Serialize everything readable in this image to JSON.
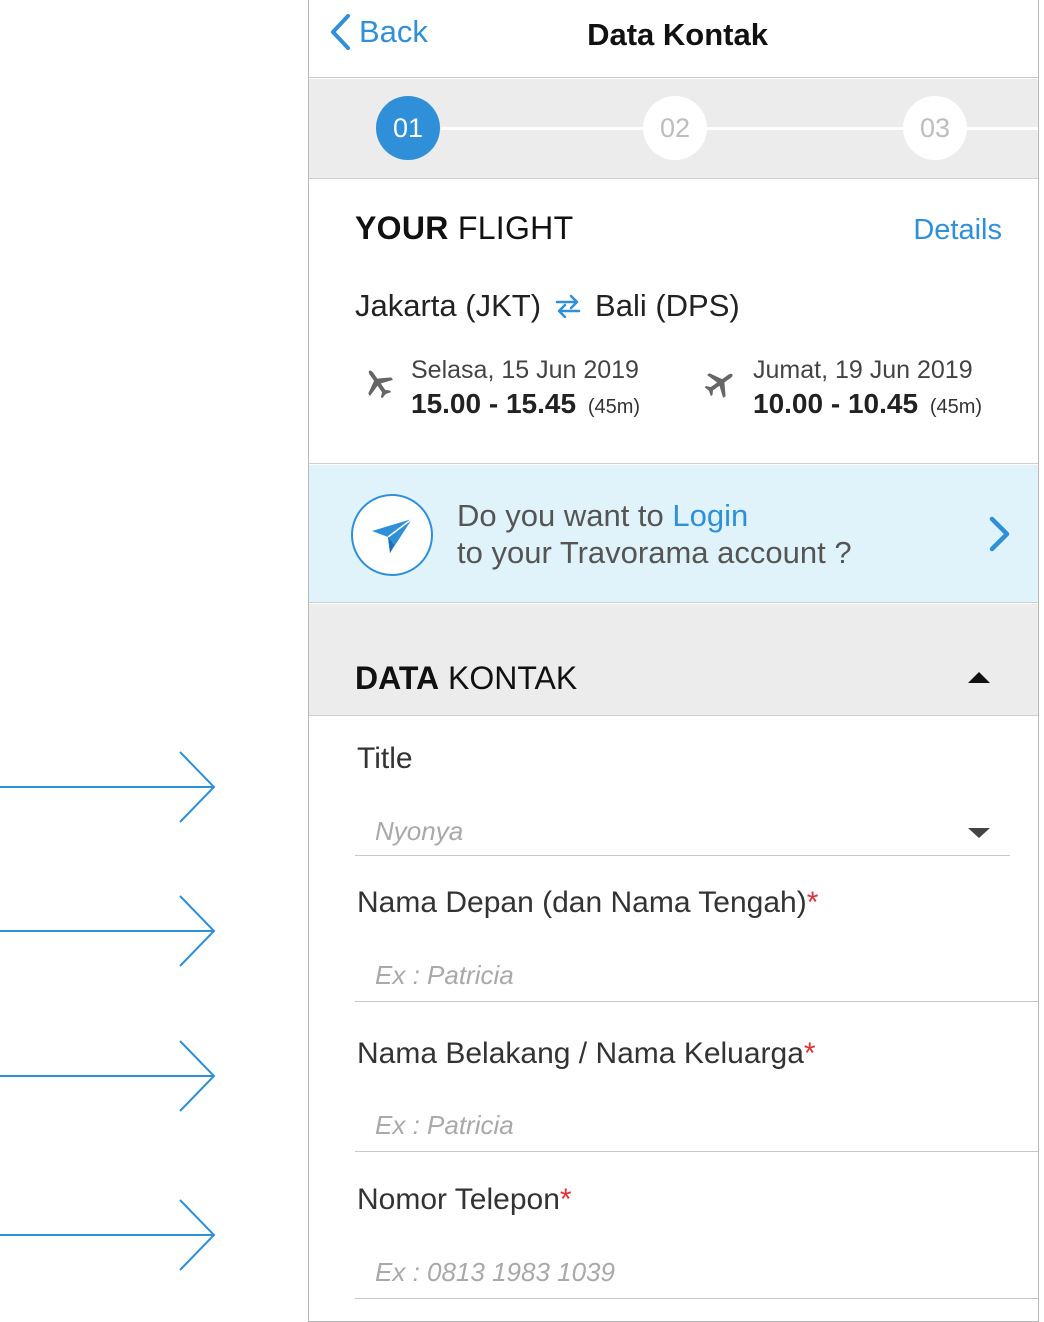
{
  "header": {
    "back_label": "Back",
    "title": "Data Kontak"
  },
  "stepper": {
    "steps": [
      "01",
      "02",
      "03"
    ],
    "active_index": 0
  },
  "flight": {
    "heading_bold": "YOUR",
    "heading_light": "FLIGHT",
    "details_label": "Details",
    "origin": "Jakarta (JKT)",
    "destination": "Bali (DPS)",
    "departure": {
      "date": "Selasa, 15 Jun 2019",
      "time": "15.00 - 15.45",
      "duration": "(45m)"
    },
    "return": {
      "date": "Jumat, 19 Jun 2019",
      "time": "10.00 - 10.45",
      "duration": "(45m)"
    }
  },
  "login_banner": {
    "line1_prefix": "Do you want to ",
    "line1_link": "Login",
    "line2": "to your Travorama account ?"
  },
  "contact_section": {
    "title_bold": "DATA",
    "title_light": "KONTAK"
  },
  "form": {
    "title_label": "Title",
    "title_value": "Nyonya",
    "first_name_label": "Nama Depan (dan Nama Tengah)",
    "first_name_placeholder": "Ex : Patricia",
    "last_name_label": "Nama Belakang / Nama Keluarga",
    "last_name_placeholder": "Ex : Patricia",
    "phone_label": "Nomor Telepon",
    "phone_placeholder": "Ex : 0813 1983 1039",
    "required_mark": "*"
  },
  "colors": {
    "accent": "#2f8fd8",
    "required": "#e0303a",
    "banner_bg": "#e1f3fa",
    "section_bg": "#ececec"
  },
  "icons": {
    "back": "chevron-left-icon",
    "swap": "swap-arrows-icon",
    "departure": "plane-takeoff-icon",
    "return": "plane-landing-icon",
    "login": "paper-plane-icon",
    "go": "chevron-right-icon",
    "collapse": "caret-up-icon",
    "dropdown": "caret-down-icon",
    "annotation": "arrow-right-icon"
  }
}
